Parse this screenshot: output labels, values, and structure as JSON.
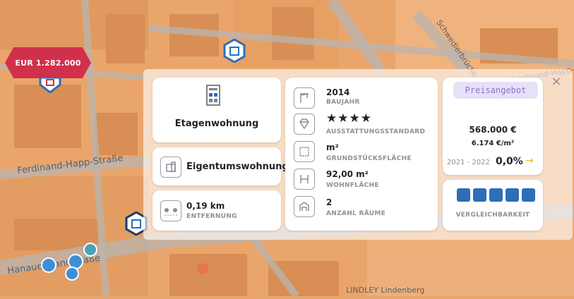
{
  "map": {
    "price_marker": "EUR 1.282.000",
    "streets": [
      "Ferdinand-Happ-Straße",
      "Hanauer Landstraße",
      "Schwedlerbrücke",
      "Ferdinand-Happ-Str.",
      "LINDLEY Lindenberg"
    ]
  },
  "panel": {
    "property_type": {
      "label": "Etagenwohnung"
    },
    "ownership": {
      "label": "Eigentumswohnung"
    },
    "distance": {
      "value": "0,19 km",
      "label": "ENTFERNUNG"
    },
    "details": [
      {
        "value": "2014",
        "label": "BAUJAHR"
      },
      {
        "value": "★★★★",
        "label": "AUSSTATTUNGSSTANDARD"
      },
      {
        "value": "m²",
        "label": "GRUNDSTÜCKSFLÄCHE"
      },
      {
        "value": "92,00 m²",
        "label": "WOHNFLÄCHE"
      },
      {
        "value": "2",
        "label": "ANZAHL RÄUME"
      }
    ],
    "offer": {
      "badge": "Preisangebot",
      "price": "568.000 €",
      "per_sqm": "6.174 €/m²",
      "period": "2021 - 2022",
      "change": "0,0%",
      "arrow": "→"
    },
    "comparability": {
      "label": "VERGLEICHBARKEIT",
      "bars": 5,
      "filled": 5
    }
  },
  "colors": {
    "accent": "#2d6eb8",
    "marker": "#d0304b",
    "badge_bg": "#e6e1f7",
    "arrow": "#f2b21b"
  }
}
